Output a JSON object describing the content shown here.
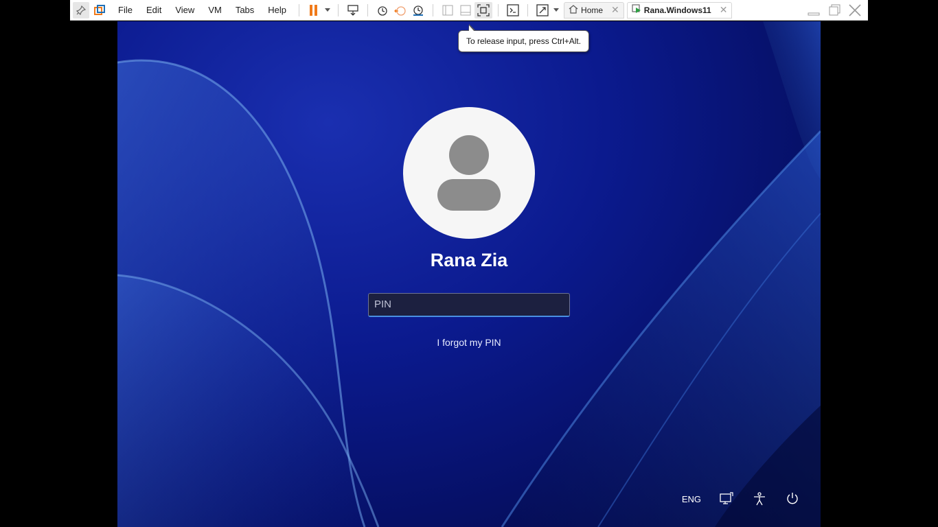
{
  "toolbar": {
    "menu": [
      "File",
      "Edit",
      "View",
      "VM",
      "Tabs",
      "Help"
    ],
    "tabs": [
      {
        "label": "Home",
        "icon": "home-icon"
      },
      {
        "label": "Rana.Windows11",
        "icon": "vm-running-icon"
      }
    ],
    "accent_color": "#f07a1a"
  },
  "tooltip": {
    "text": "To release input, press Ctrl+Alt."
  },
  "lock_screen": {
    "user_name": "Rana Zia",
    "pin_placeholder": "PIN",
    "forgot_link": "I forgot my PIN",
    "language": "ENG",
    "background_color": "#0b1a8e"
  }
}
